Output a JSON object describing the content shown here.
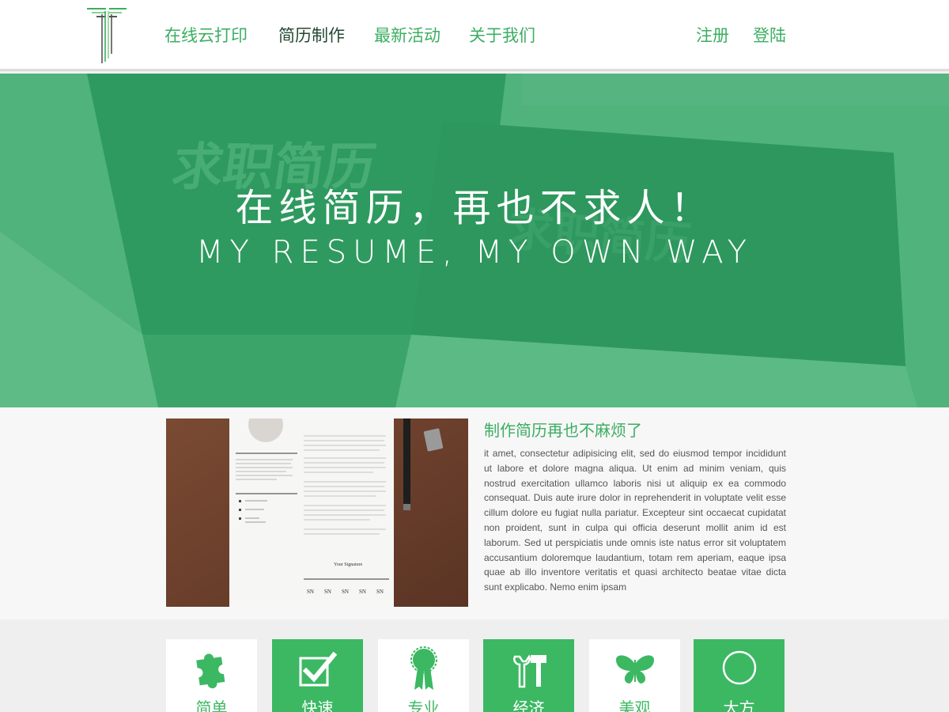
{
  "nav": {
    "items": [
      "在线云打印",
      "简历制作",
      "最新活动",
      "关于我们"
    ],
    "register": "注册",
    "login": "登陆"
  },
  "hero": {
    "title": "在线简历，再也不求人！",
    "subtitle": "MY RESUME, MY OWN WAY",
    "background_text": "求职简历"
  },
  "intro": {
    "title": "制作简历再也不麻烦了",
    "text": "it amet, consectetur adipisicing elit, sed do eiusmod tempor incididunt ut labore et dolore magna aliqua. Ut enim ad minim veniam, quis nostrud exercitation ullamco laboris nisi ut aliquip ex ea commodo consequat. Duis aute irure dolor in reprehenderit in voluptate velit esse cillum dolore eu fugiat nulla pariatur. Excepteur sint occaecat cupidatat non proident, sunt in culpa qui officia deserunt mollit anim id est laborum. Sed ut perspiciatis unde omnis iste natus error sit voluptatem accusantium doloremque laudantium, totam rem aperiam, eaque ipsa quae ab illo inventore veritatis et quasi architecto beatae vitae dicta sunt explicabo. Nemo enim ipsam",
    "photo": {
      "signature": "Your Signature",
      "initials": "SN"
    }
  },
  "features": [
    {
      "label": "简单",
      "icon": "puzzle-icon"
    },
    {
      "label": "快速",
      "icon": "checkbox-icon"
    },
    {
      "label": "专业",
      "icon": "award-ribbon-icon"
    },
    {
      "label": "经济",
      "icon": "tools-icon"
    },
    {
      "label": "美观",
      "icon": "butterfly-icon"
    },
    {
      "label": "大方",
      "icon": "circle-icon"
    }
  ],
  "colors": {
    "brand_green": "#3cae62",
    "nav_active": "#234a33",
    "hero_green": "#4fb37b",
    "feature_green": "#3cb863"
  }
}
